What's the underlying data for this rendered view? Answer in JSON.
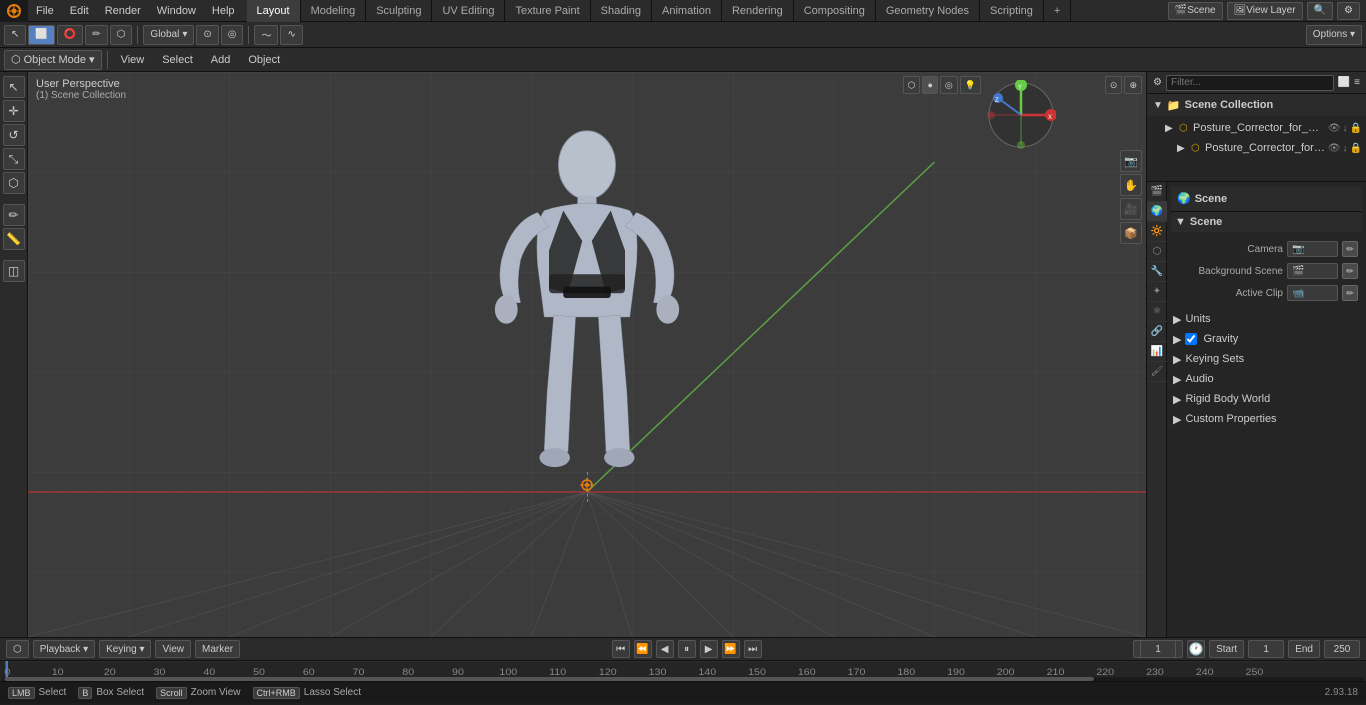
{
  "app": {
    "title": "Blender"
  },
  "topMenu": {
    "items": [
      "File",
      "Edit",
      "Render",
      "Window",
      "Help"
    ]
  },
  "workspaceTabs": {
    "tabs": [
      "Layout",
      "Modeling",
      "Sculpting",
      "UV Editing",
      "Texture Paint",
      "Shading",
      "Animation",
      "Rendering",
      "Compositing",
      "Geometry Nodes",
      "Scripting"
    ],
    "active": "Layout",
    "plus": "+"
  },
  "topRight": {
    "sceneLabel": "Scene",
    "layerLabel": "View Layer",
    "searchPlaceholder": "🔍"
  },
  "toolbar": {
    "globalLabel": "Global",
    "snapLabel": "⊙",
    "proportionalLabel": "O",
    "optionsLabel": "Options ▾"
  },
  "headerRow": {
    "objectModeLabel": "Object Mode ▾",
    "viewLabel": "View",
    "selectLabel": "Select",
    "addLabel": "Add",
    "objectLabel": "Object"
  },
  "viewport": {
    "label": "User Perspective",
    "sublabel": "(1) Scene Collection",
    "overlayButtons": [
      "Global ▾",
      "⊙▾",
      "○▾",
      "~"
    ],
    "rightButtons": [
      "🔍",
      "📷",
      "✋",
      "📹",
      "📦"
    ],
    "navGizmo": "⊕"
  },
  "leftTools": {
    "tools": [
      "⬡",
      "↕",
      "↺",
      "✦",
      "✂",
      "◻",
      "△",
      "◫"
    ]
  },
  "outliner": {
    "title": "Scene Collection",
    "searchPlaceholder": "Filter...",
    "items": [
      {
        "indent": 0,
        "icon": "▶",
        "label": "Posture_Corrector_for_Wome",
        "actions": [
          "👁",
          "🔒",
          "⬇"
        ]
      },
      {
        "indent": 1,
        "icon": "▶",
        "label": "Posture_Corrector_for_W",
        "actions": [
          "👁",
          "🔒",
          "⬇"
        ]
      }
    ]
  },
  "propertiesPanel": {
    "headerTitle": "Scene",
    "tabs": [
      "🔧",
      "🌍",
      "🎬",
      "🔆",
      "🖼",
      "🎞",
      "⬡",
      "🔑",
      "🔊",
      "⚙",
      "📦",
      "⚛"
    ],
    "activeTab": 1,
    "sceneName": "Scene",
    "sections": [
      {
        "id": "scene",
        "label": "Scene",
        "expanded": true,
        "rows": [
          {
            "label": "Camera",
            "type": "dropdown",
            "value": ""
          },
          {
            "label": "Background Scene",
            "type": "picker",
            "value": ""
          },
          {
            "label": "Active Clip",
            "type": "picker",
            "value": ""
          }
        ]
      },
      {
        "id": "units",
        "label": "Units",
        "expanded": false
      },
      {
        "id": "gravity",
        "label": "Gravity",
        "expanded": false,
        "hasCheckbox": true,
        "checked": true
      },
      {
        "id": "keying-sets",
        "label": "Keying Sets",
        "expanded": false
      },
      {
        "id": "audio",
        "label": "Audio",
        "expanded": false
      },
      {
        "id": "rigid-body-world",
        "label": "Rigid Body World",
        "expanded": false
      },
      {
        "id": "custom-properties",
        "label": "Custom Properties",
        "expanded": false
      }
    ]
  },
  "timeline": {
    "playbackLabel": "Playback ▾",
    "keyingLabel": "Keying ▾",
    "viewLabel": "View",
    "markerLabel": "Marker",
    "frameNumbers": [
      0,
      10,
      20,
      30,
      40,
      50,
      60,
      70,
      80,
      90,
      100,
      110,
      120,
      130,
      140,
      150,
      160,
      170,
      180,
      190,
      200,
      210,
      220,
      230,
      240,
      250
    ],
    "currentFrame": "1",
    "startFrame": "1",
    "endFrame": "250",
    "startLabel": "Start",
    "endLabel": "End",
    "frameCurrent": "1"
  },
  "statusBar": {
    "selectLabel": "Select",
    "boxSelectLabel": "Box Select",
    "zoomViewLabel": "Zoom View",
    "lassoSelectLabel": "Lasso Select",
    "versionLabel": "2.93.18"
  },
  "colors": {
    "accent": "#5680c2",
    "background": "#3c3c3c",
    "panelBg": "#252525",
    "headerBg": "#2b2b2b",
    "redAxis": "#cc3333",
    "greenAxis": "#66cc44",
    "blueAxis": "#4477cc"
  }
}
